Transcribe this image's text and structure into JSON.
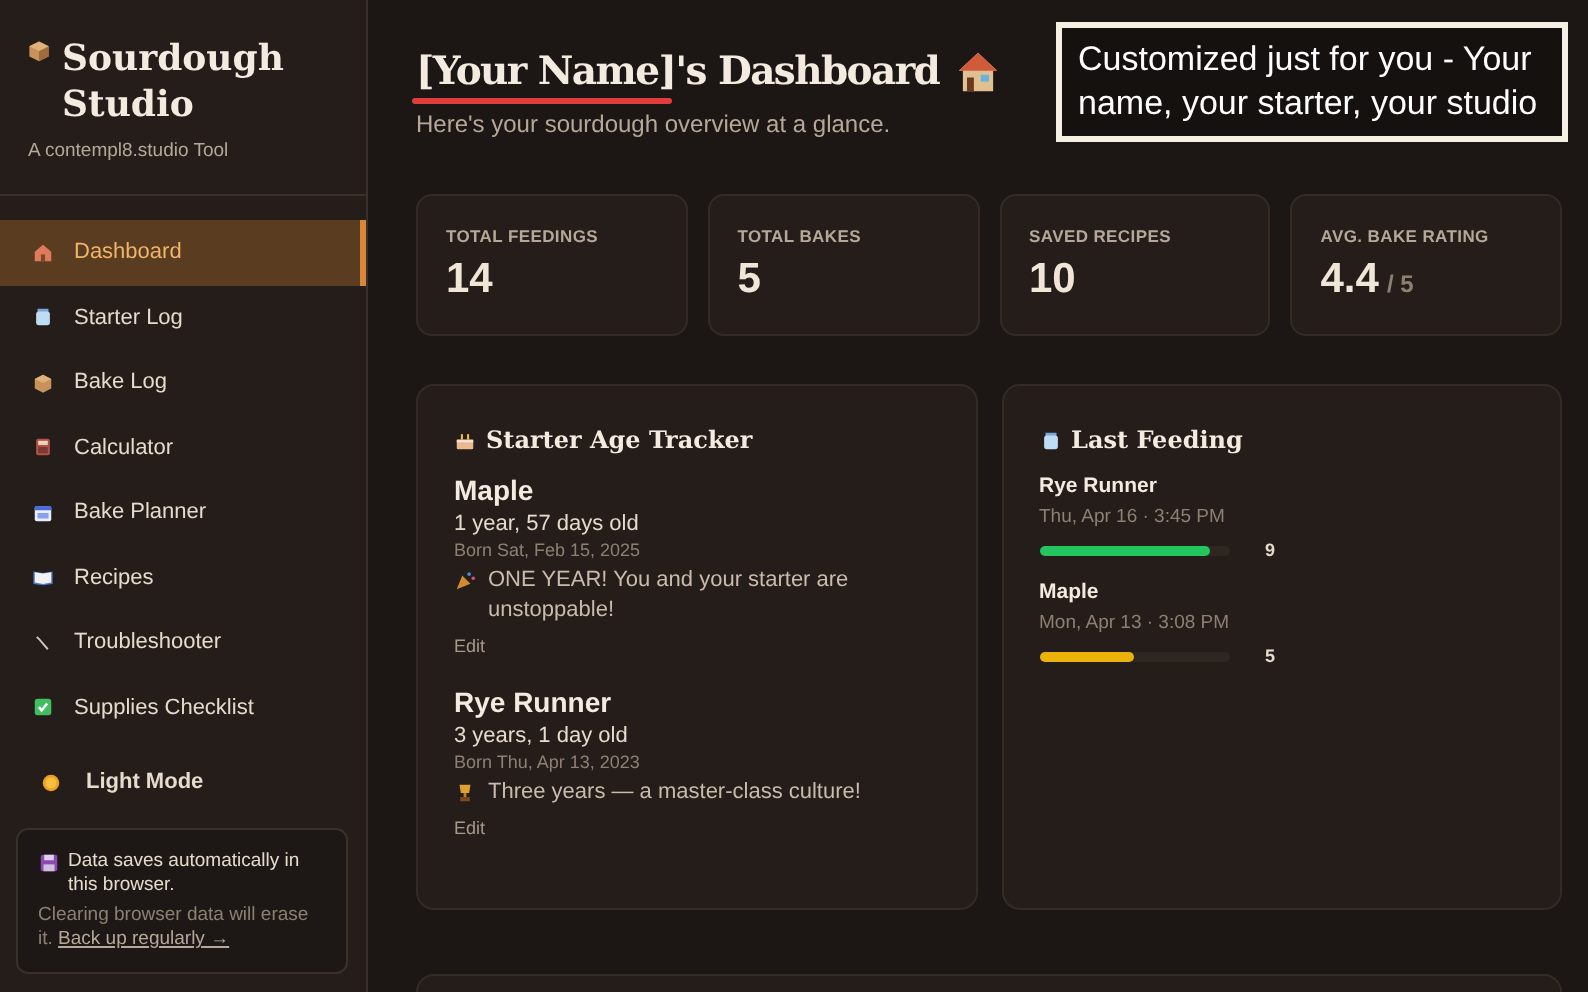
{
  "sidebar": {
    "title": "Sourdough Studio",
    "subtitle": "A contempl8.studio Tool",
    "items": [
      {
        "label": "Dashboard",
        "selected": true
      },
      {
        "label": "Starter Log",
        "selected": false
      },
      {
        "label": "Bake Log",
        "selected": false
      },
      {
        "label": "Calculator",
        "selected": false
      },
      {
        "label": "Bake Planner",
        "selected": false
      },
      {
        "label": "Recipes",
        "selected": false
      },
      {
        "label": "Troubleshooter",
        "selected": false
      },
      {
        "label": "Supplies Checklist",
        "selected": false
      }
    ],
    "theme_toggle": "Light Mode",
    "notice": {
      "text": "Data saves automatically in this browser.",
      "detail": "Clearing browser data will erase it.",
      "link": "Back up regularly →"
    }
  },
  "header": {
    "title": "[Your Name]'s Dashboard",
    "subtitle": "Here's your sourdough overview at a glance."
  },
  "annotation": "Customized just for you - Your name, your starter, your studio",
  "stats": [
    {
      "label": "TOTAL FEEDINGS",
      "value": "14"
    },
    {
      "label": "TOTAL BAKES",
      "value": "5"
    },
    {
      "label": "SAVED RECIPES",
      "value": "10"
    },
    {
      "label": "AVG. BAKE RATING",
      "value": "4.4",
      "suffix": "/ 5"
    }
  ],
  "starter_age": {
    "title": "Starter Age Tracker",
    "starters": [
      {
        "name": "Maple",
        "age": "1 year, 57 days old",
        "born": "Born Sat, Feb 15, 2025",
        "milestone": "ONE YEAR! You and your starter are unstoppable!",
        "edit": "Edit"
      },
      {
        "name": "Rye Runner",
        "age": "3 years, 1 day old",
        "born": "Born Thu, Apr 13, 2023",
        "milestone": "Three years — a master-class culture!",
        "edit": "Edit"
      }
    ]
  },
  "last_feeding": {
    "title": "Last Feeding",
    "starters": [
      {
        "name": "Rye Runner",
        "time": "Thu, Apr 16 · 3:45 PM",
        "level": 0.9,
        "color": "#22c55e",
        "score": "9"
      },
      {
        "name": "Maple",
        "time": "Mon, Apr 13 · 3:08 PM",
        "level": 0.5,
        "color": "#eab308",
        "score": "5"
      }
    ]
  }
}
